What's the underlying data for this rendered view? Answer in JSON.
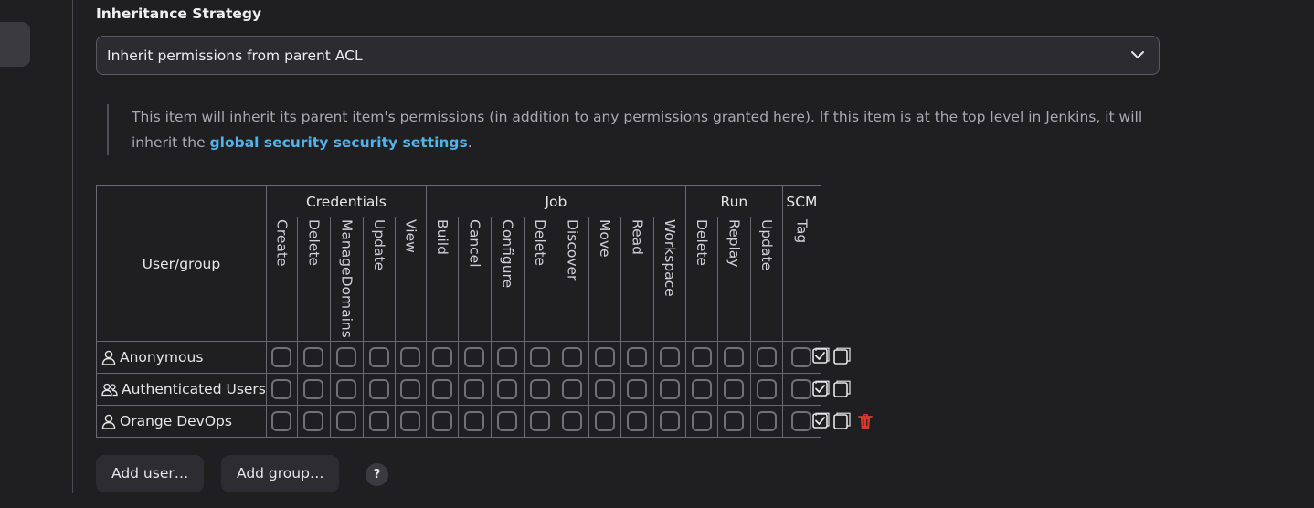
{
  "form": {
    "strategy_label": "Inheritance Strategy",
    "strategy_value": "Inherit permissions from parent ACL",
    "help_text_before": "This item will inherit its parent item's permissions (in addition to any permissions granted here). If this item is at the top level in Jenkins, it will inherit the ",
    "help_link": "global security security settings",
    "help_text_after": "."
  },
  "matrix": {
    "user_group_header": "User/group",
    "groups": [
      {
        "name": "Credentials",
        "permissions": [
          "Create",
          "Delete",
          "ManageDomains",
          "Update",
          "View"
        ]
      },
      {
        "name": "Job",
        "permissions": [
          "Build",
          "Cancel",
          "Configure",
          "Delete",
          "Discover",
          "Move",
          "Read",
          "Workspace"
        ]
      },
      {
        "name": "Run",
        "permissions": [
          "Delete",
          "Replay",
          "Update"
        ]
      },
      {
        "name": "SCM",
        "permissions": [
          "Tag"
        ]
      }
    ],
    "rows": [
      {
        "name": "Anonymous",
        "icon": "user-icon",
        "deletable": false
      },
      {
        "name": "Authenticated Users",
        "icon": "users-icon",
        "deletable": false
      },
      {
        "name": "Orange DevOps",
        "icon": "user-icon",
        "deletable": true
      }
    ]
  },
  "buttons": {
    "add_user": "Add user…",
    "add_group": "Add group…",
    "help": "?"
  },
  "colors": {
    "background": "#1f1f22",
    "link": "#4fb3ec",
    "delete": "#d63a2f"
  }
}
